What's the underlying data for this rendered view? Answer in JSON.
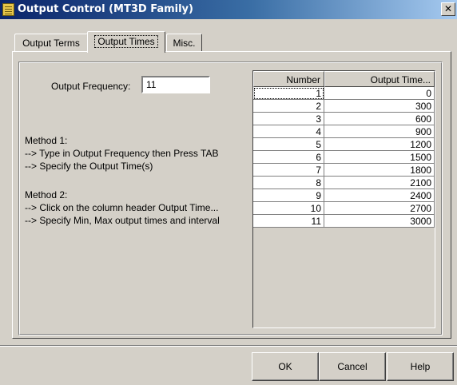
{
  "window": {
    "title": "Output Control (MT3D Family)",
    "close_glyph": "✕"
  },
  "tabs": [
    {
      "label": "Output Terms"
    },
    {
      "label": "Output Times"
    },
    {
      "label": "Misc."
    }
  ],
  "active_tab": "Output Times",
  "output_frequency": {
    "label": "Output Frequency:",
    "value": "11"
  },
  "instructions": {
    "method1_title": "Method 1:",
    "method1_step1": "--> Type in Output Frequency then Press TAB",
    "method1_step2": "--> Specify the Output Time(s)",
    "method2_title": "Method 2:",
    "method2_step1": "--> Click on the column header Output Time...",
    "method2_step2": "--> Specify Min, Max output times and interval"
  },
  "table": {
    "columns": [
      "Number",
      "Output Time..."
    ],
    "rows": [
      [
        "1",
        "0"
      ],
      [
        "2",
        "300"
      ],
      [
        "3",
        "600"
      ],
      [
        "4",
        "900"
      ],
      [
        "5",
        "1200"
      ],
      [
        "6",
        "1500"
      ],
      [
        "7",
        "1800"
      ],
      [
        "8",
        "2100"
      ],
      [
        "9",
        "2400"
      ],
      [
        "10",
        "2700"
      ],
      [
        "11",
        "3000"
      ]
    ]
  },
  "buttons": {
    "ok": "OK",
    "cancel": "Cancel",
    "help": "Help"
  },
  "icons": {
    "window": "list-document-icon",
    "close": "close-icon"
  },
  "colors": {
    "titlebar_start": "#0a246a",
    "titlebar_end": "#a6caf0",
    "face": "#d4d0c8"
  }
}
